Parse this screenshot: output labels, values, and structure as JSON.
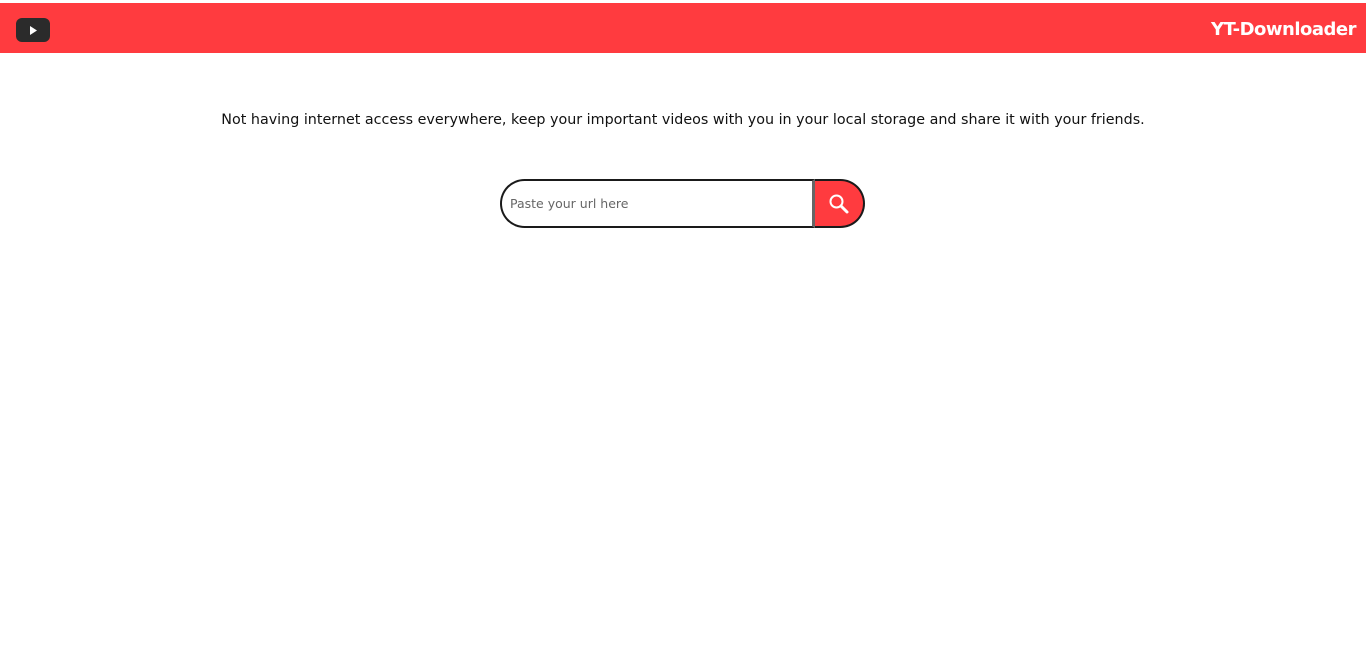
{
  "header": {
    "logo_icon": "play-icon",
    "brand": "YT-Downloader",
    "background_color": "#ff3b3f"
  },
  "main": {
    "tagline": "Not having internet access everywhere, keep your important videos with you in your local storage and share it with your friends."
  },
  "search": {
    "placeholder": "Paste your url here",
    "value": "",
    "button_icon": "search-icon"
  }
}
